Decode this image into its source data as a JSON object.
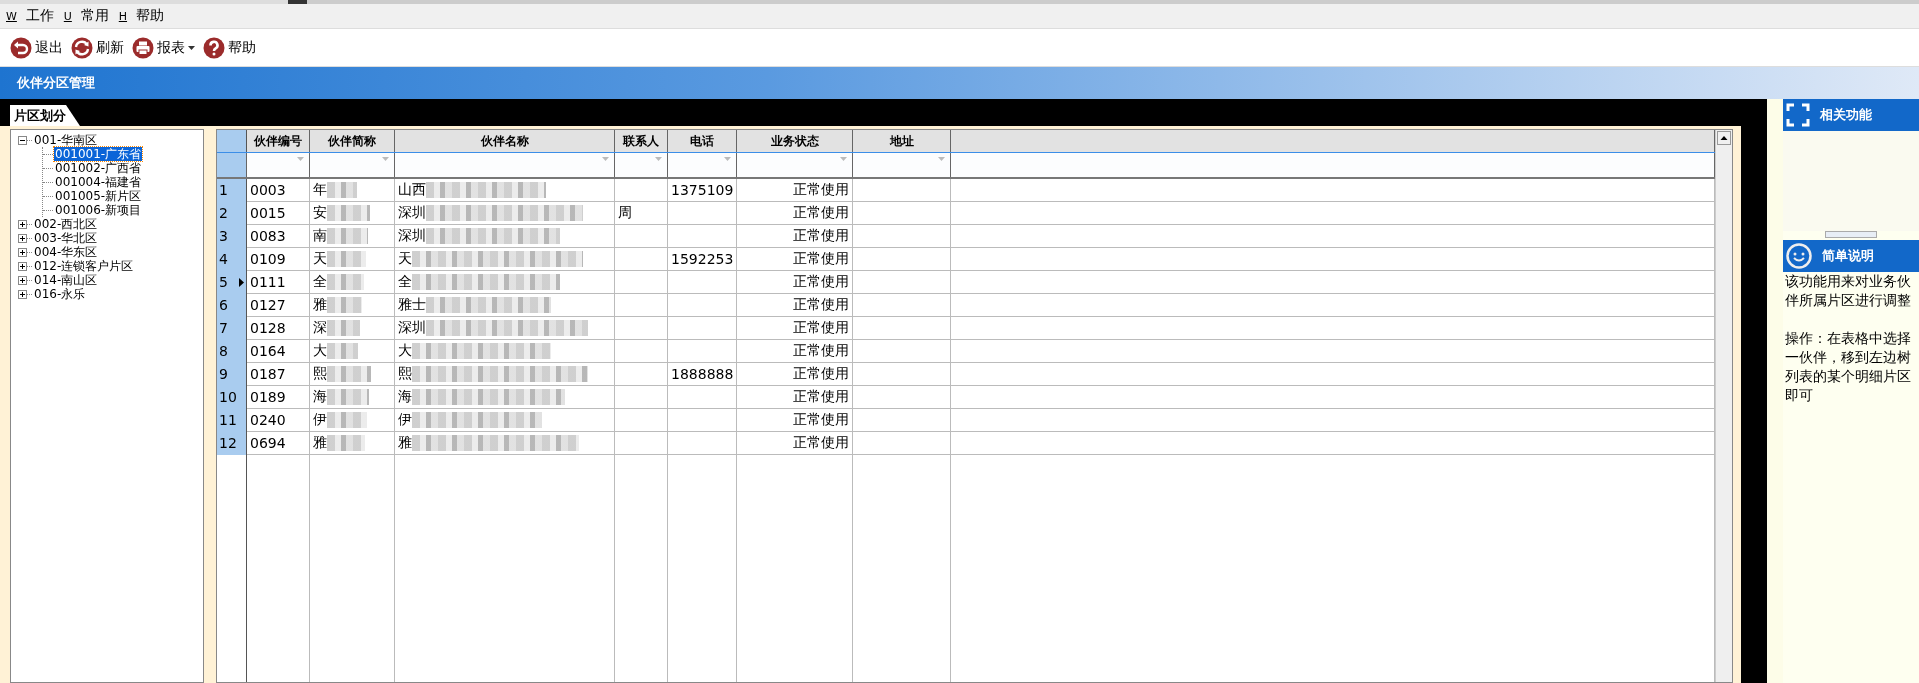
{
  "menu": [
    {
      "key": "W",
      "label": "工作"
    },
    {
      "key": "U",
      "label": "常用"
    },
    {
      "key": "H",
      "label": "帮助"
    }
  ],
  "toolbar": [
    {
      "kind": "exit",
      "label": "退出",
      "dropdown": false
    },
    {
      "kind": "refresh",
      "label": "刷新",
      "dropdown": false
    },
    {
      "kind": "print",
      "label": "报表",
      "dropdown": true
    },
    {
      "kind": "help",
      "label": "帮助",
      "dropdown": false
    }
  ],
  "page_title": "伙伴分区管理",
  "tabs": [
    {
      "label": "片区划分",
      "selected": true
    }
  ],
  "tree": [
    {
      "label": "001-华南区",
      "expanded": true,
      "selected": false,
      "children": [
        {
          "label": "001001-广东省",
          "selected": true
        },
        {
          "label": "001002-广西省",
          "selected": false
        },
        {
          "label": "001004-福建省",
          "selected": false
        },
        {
          "label": "001005-新片区",
          "selected": false
        },
        {
          "label": "001006-新项目",
          "selected": false
        }
      ]
    },
    {
      "label": "002-西北区",
      "expanded": false,
      "selected": false
    },
    {
      "label": "003-华北区",
      "expanded": false,
      "selected": false
    },
    {
      "label": "004-华东区",
      "expanded": false,
      "selected": false
    },
    {
      "label": "012-连锁客户片区",
      "expanded": false,
      "selected": false
    },
    {
      "label": "014-南山区",
      "expanded": false,
      "selected": false
    },
    {
      "label": "016-永乐",
      "expanded": false,
      "selected": false
    }
  ],
  "table": {
    "columns": [
      "伙伴编号",
      "伙伴简称",
      "伙伴名称",
      "联系人",
      "电话",
      "业务状态",
      "地址"
    ],
    "rows": [
      {
        "no": "1",
        "current": false,
        "cells": [
          "0003",
          {
            "text": "年",
            "redacted": true
          },
          {
            "text": "山西",
            "redacted": true
          },
          "",
          "1375109",
          "正常使用",
          ""
        ]
      },
      {
        "no": "2",
        "current": false,
        "cells": [
          "0015",
          {
            "text": "安",
            "redacted": true
          },
          {
            "text": "深圳",
            "redacted": true
          },
          "周",
          "",
          "正常使用",
          ""
        ]
      },
      {
        "no": "3",
        "current": false,
        "cells": [
          "0083",
          {
            "text": "南",
            "redacted": true
          },
          {
            "text": "深圳",
            "redacted": true
          },
          "",
          "",
          "正常使用",
          ""
        ]
      },
      {
        "no": "4",
        "current": false,
        "cells": [
          "0109",
          {
            "text": "天",
            "redacted": true
          },
          {
            "text": "天",
            "redacted": true
          },
          "",
          "1592253",
          "正常使用",
          ""
        ]
      },
      {
        "no": "5",
        "current": true,
        "cells": [
          "0111",
          {
            "text": "全",
            "redacted": true
          },
          {
            "text": "全",
            "redacted": true
          },
          "",
          "",
          "正常使用",
          ""
        ]
      },
      {
        "no": "6",
        "current": false,
        "cells": [
          "0127",
          {
            "text": "雅",
            "redacted": true
          },
          {
            "text": "雅士",
            "redacted": true
          },
          "",
          "",
          "正常使用",
          ""
        ]
      },
      {
        "no": "7",
        "current": false,
        "cells": [
          "0128",
          {
            "text": "深",
            "redacted": true
          },
          {
            "text": "深圳",
            "redacted": true
          },
          "",
          "",
          "正常使用",
          ""
        ]
      },
      {
        "no": "8",
        "current": false,
        "cells": [
          "0164",
          {
            "text": "大",
            "redacted": true
          },
          {
            "text": "大",
            "redacted": true
          },
          "",
          "",
          "正常使用",
          ""
        ]
      },
      {
        "no": "9",
        "current": false,
        "cells": [
          "0187",
          {
            "text": "熙",
            "redacted": true
          },
          {
            "text": "熙",
            "redacted": true
          },
          "",
          "1888888",
          "正常使用",
          ""
        ]
      },
      {
        "no": "10",
        "current": false,
        "cells": [
          "0189",
          {
            "text": "海",
            "redacted": true
          },
          {
            "text": "海",
            "redacted": true
          },
          "",
          "",
          "正常使用",
          ""
        ]
      },
      {
        "no": "11",
        "current": false,
        "cells": [
          "0240",
          {
            "text": "伊",
            "redacted": true
          },
          {
            "text": "伊",
            "redacted": true
          },
          "",
          "",
          "正常使用",
          ""
        ]
      },
      {
        "no": "12",
        "current": false,
        "cells": [
          "0694",
          {
            "text": "雅",
            "redacted": true
          },
          {
            "text": "雅",
            "redacted": true
          },
          "",
          "",
          "正常使用",
          ""
        ]
      }
    ]
  },
  "side_panel": [
    {
      "kind": "functions",
      "title": "相关功能"
    },
    {
      "kind": "notes",
      "title": "简单说明",
      "paragraphs": [
        "该功能用来对业务伙伴所属片区进行调整",
        "操作：在表格中选择一伙伴，移到左边树列表的某个明细片区即可"
      ]
    }
  ]
}
